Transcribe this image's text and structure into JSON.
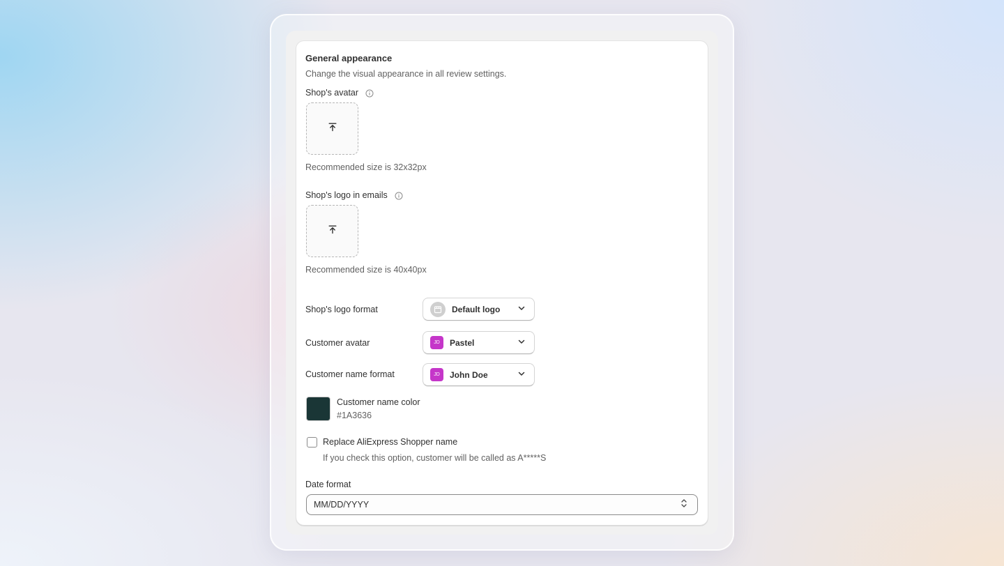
{
  "section": {
    "title": "General appearance",
    "subtitle": "Change the visual appearance in all review settings."
  },
  "avatar_upload": {
    "label": "Shop's avatar",
    "hint": "Recommended size is 32x32px"
  },
  "logo_upload": {
    "label": "Shop's logo in emails",
    "hint": "Recommended size is 40x40px"
  },
  "logo_format": {
    "label": "Shop's logo format",
    "value": "Default logo"
  },
  "customer_avatar": {
    "label": "Customer avatar",
    "badge": "JD",
    "value": "Pastel"
  },
  "customer_name_format": {
    "label": "Customer name format",
    "badge": "JD",
    "value": "John Doe"
  },
  "customer_name_color": {
    "label": "Customer name color",
    "value": "#1A3636"
  },
  "replace_shopper": {
    "label": "Replace AliExpress Shopper name",
    "help": "If you check this option, customer will be called as A*****S",
    "checked": false
  },
  "date_format": {
    "label": "Date format",
    "value": "MM/DD/YYYY"
  },
  "icons": {
    "info": "info-icon",
    "upload": "upload-icon",
    "chevron": "chevron-down-icon",
    "select_arrows": "select-arrows-icon",
    "store": "store-icon"
  },
  "colors": {
    "badge": "#C536C9",
    "swatch": "#1A3636"
  }
}
